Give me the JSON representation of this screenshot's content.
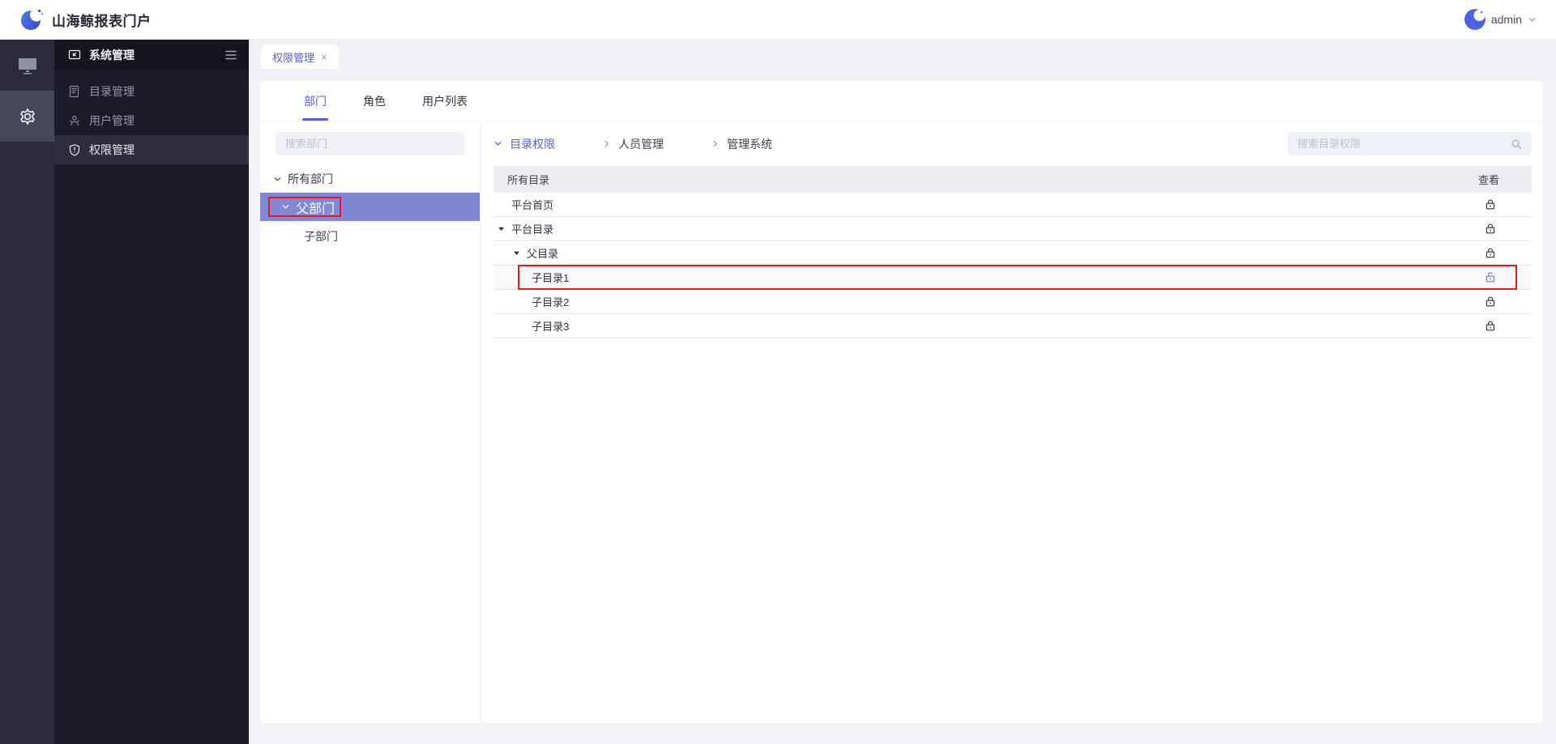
{
  "header": {
    "title": "山海鲸报表门户",
    "user_name": "admin"
  },
  "rail": {
    "items": [
      {
        "name": "screens"
      },
      {
        "name": "settings",
        "active": true
      }
    ]
  },
  "sidebar": {
    "title": "系统管理",
    "items": [
      {
        "label": "目录管理"
      },
      {
        "label": "用户管理"
      },
      {
        "label": "权限管理",
        "active": true
      }
    ]
  },
  "tabstrip": {
    "active_tab": "权限管理",
    "close_glyph": "×"
  },
  "main": {
    "tabs": [
      {
        "label": "部门"
      },
      {
        "label": "角色"
      },
      {
        "label": "用户列表"
      }
    ],
    "dept_panel": {
      "search_placeholder": "搜索部门",
      "tree": [
        {
          "label": "所有部门",
          "expanded": true
        },
        {
          "label": "父部门",
          "expanded": true,
          "selected": true,
          "red_outline": true
        },
        {
          "label": "子部门"
        }
      ]
    },
    "perm_panel": {
      "sections": [
        {
          "label": "目录权限",
          "state": "expanded",
          "active": true
        },
        {
          "label": "人员管理",
          "state": "collapsed"
        },
        {
          "label": "管理系统",
          "state": "collapsed"
        }
      ],
      "search_placeholder": "搜索目录权限",
      "table": {
        "title_col": "所有目录",
        "view_col": "查看",
        "rows": [
          {
            "label": "平台首页",
            "lock": "locked"
          },
          {
            "label": "平台目录",
            "lock": "locked",
            "caret": true
          },
          {
            "label": "父目录",
            "lock": "locked",
            "caret": true
          },
          {
            "label": "子目录1",
            "lock": "unlocked",
            "red_outline": true
          },
          {
            "label": "子目录2",
            "lock": "locked"
          },
          {
            "label": "子目录3",
            "lock": "locked"
          }
        ]
      }
    }
  },
  "colors": {
    "accent": "#5a5fc8",
    "selected_tree_row": "#8287d8",
    "annotation_red": "#e01d1d",
    "unlocked_lock": "#6f74d8",
    "sidebar_bg": "#1c1c29",
    "rail_bg": "#2a2a3c"
  }
}
